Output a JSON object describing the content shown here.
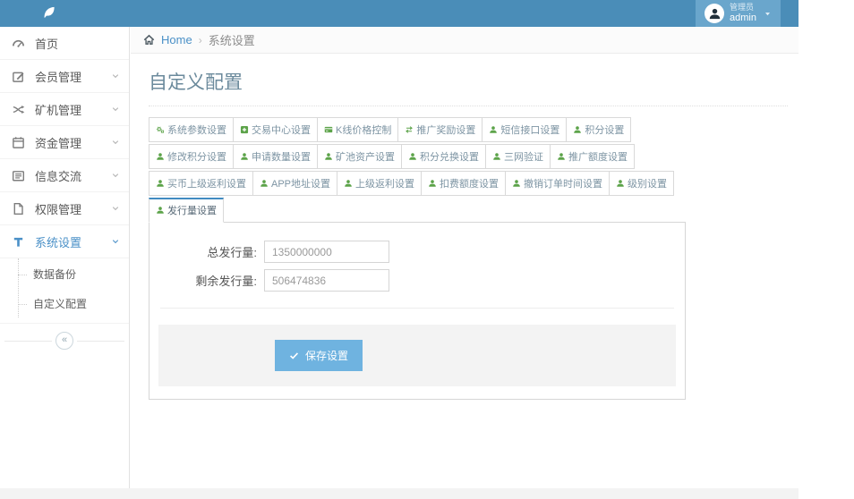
{
  "header": {
    "logo_icon": "leaf-icon",
    "user": {
      "role": "管理员",
      "name": "admin"
    }
  },
  "breadcrumb": {
    "home_label": "Home",
    "separator": "›",
    "current": "系统设置"
  },
  "sidebar": {
    "items": [
      {
        "label": "首页",
        "icon": "dashboard-icon",
        "expandable": false,
        "active": false
      },
      {
        "label": "会员管理",
        "icon": "edit-icon",
        "expandable": true,
        "active": false
      },
      {
        "label": "矿机管理",
        "icon": "shuffle-icon",
        "expandable": true,
        "active": false
      },
      {
        "label": "资金管理",
        "icon": "calendar-icon",
        "expandable": true,
        "active": false
      },
      {
        "label": "信息交流",
        "icon": "list-icon",
        "expandable": true,
        "active": false
      },
      {
        "label": "权限管理",
        "icon": "file-icon",
        "expandable": true,
        "active": false
      },
      {
        "label": "系统设置",
        "icon": "text-icon",
        "expandable": true,
        "active": true
      }
    ],
    "subitems": [
      {
        "label": "数据备份"
      },
      {
        "label": "自定义配置"
      }
    ],
    "collapse_glyph": "«"
  },
  "page": {
    "title": "自定义配置"
  },
  "tabs": {
    "rows": [
      [
        {
          "label": "系统参数设置",
          "icon": "gears-icon",
          "active": false
        },
        {
          "label": "交易中心设置",
          "icon": "plus-square-icon",
          "active": false
        },
        {
          "label": "K线价格控制",
          "icon": "kline-icon",
          "active": false
        },
        {
          "label": "推广奖励设置",
          "icon": "exchange-icon",
          "active": false
        },
        {
          "label": "短信接口设置",
          "icon": "user-icon",
          "active": false
        },
        {
          "label": "积分设置",
          "icon": "user-icon",
          "active": false
        }
      ],
      [
        {
          "label": "修改积分设置",
          "icon": "user-icon",
          "active": false
        },
        {
          "label": "申请数量设置",
          "icon": "user-icon",
          "active": false
        },
        {
          "label": "矿池资产设置",
          "icon": "user-icon",
          "active": false
        },
        {
          "label": "积分兑换设置",
          "icon": "user-icon",
          "active": false
        },
        {
          "label": "三网验证",
          "icon": "user-icon",
          "active": false
        },
        {
          "label": "推广额度设置",
          "icon": "user-icon",
          "active": false
        }
      ],
      [
        {
          "label": "买币上级返利设置",
          "icon": "user-icon",
          "active": false
        },
        {
          "label": "APP地址设置",
          "icon": "user-icon",
          "active": false
        },
        {
          "label": "上级返利设置",
          "icon": "user-icon",
          "active": false
        },
        {
          "label": "扣费额度设置",
          "icon": "user-icon",
          "active": false
        },
        {
          "label": "撤销订单时间设置",
          "icon": "user-icon",
          "active": false
        },
        {
          "label": "级别设置",
          "icon": "user-icon",
          "active": false
        }
      ],
      [
        {
          "label": "发行量设置",
          "icon": "user-icon",
          "active": true
        }
      ]
    ]
  },
  "form": {
    "fields": [
      {
        "label": "总发行量:",
        "value": "1350000000"
      },
      {
        "label": "剩余发行量:",
        "value": "506474836"
      }
    ],
    "save_label": "保存设置",
    "save_icon": "check-icon"
  },
  "colors": {
    "navbar": "#4a8db8",
    "user_panel": "#6aa6cc",
    "accent": "#4a90c7",
    "tab_icon_green": "#5ca349",
    "save_button": "#6fb3e0",
    "actions_bg": "#f3f3f3"
  }
}
